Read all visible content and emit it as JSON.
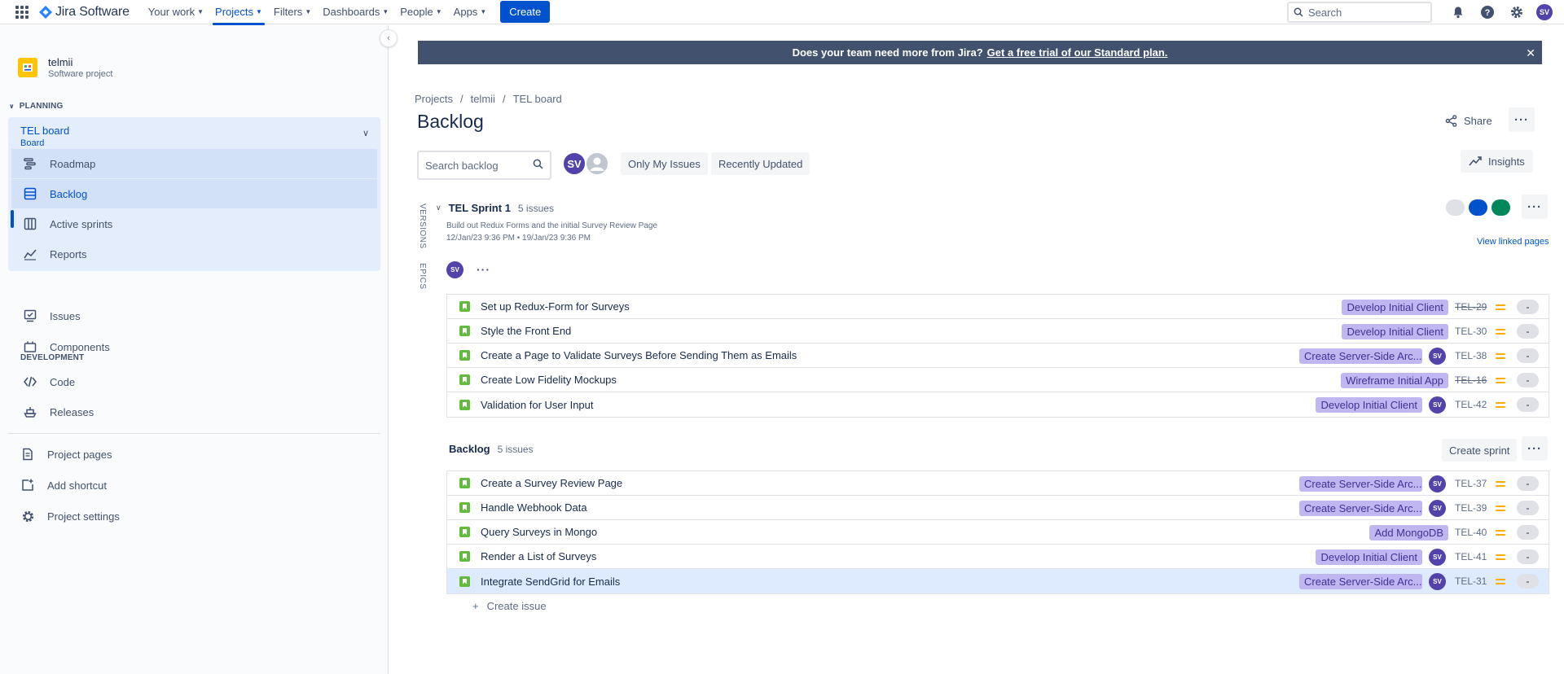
{
  "topnav": {
    "product": "Jira Software",
    "items": [
      "Your work",
      "Projects",
      "Filters",
      "Dashboards",
      "People",
      "Apps"
    ],
    "create_label": "Create",
    "search_placeholder": "Search",
    "user_initials": "SV"
  },
  "sidebar": {
    "project_name": "telmii",
    "project_type": "Software project",
    "planning_title": "PLANNING",
    "board_name": "TEL board",
    "board_type": "Board",
    "board_items": [
      "Roadmap",
      "Backlog",
      "Active sprints",
      "Reports"
    ],
    "items": [
      "Issues",
      "Components"
    ],
    "development_title": "DEVELOPMENT",
    "dev_items": [
      "Code",
      "Releases"
    ],
    "bottom_items": [
      "Project pages",
      "Add shortcut",
      "Project settings"
    ]
  },
  "banner": {
    "text": "Does your team need more from Jira?",
    "link": "Get a free trial of our Standard plan."
  },
  "breadcrumb": [
    "Projects",
    "telmii",
    "TEL board"
  ],
  "page_title": "Backlog",
  "share_label": "Share",
  "search_placeholder": "Search backlog",
  "filter_avatar": "SV",
  "filters": [
    "Only My Issues",
    "Recently Updated"
  ],
  "insights_label": "Insights",
  "side_tabs": [
    "VERSIONS",
    "EPICS"
  ],
  "sprint": {
    "name": "TEL Sprint 1",
    "count": "5 issues",
    "goal": "Build out Redux Forms and the initial Survey Review Page",
    "dates": "12/Jan/23 9:36 PM • 19/Jan/23 9:36 PM",
    "status_colors": [
      "#dfe1e6",
      "#0052cc",
      "#00875a"
    ],
    "view_linked": "View linked pages",
    "avatar": "SV",
    "issues": [
      {
        "summary": "Set up Redux-Form for Surveys",
        "epic": "Develop Initial Client",
        "avatar": "",
        "key": "TEL-29",
        "done": true,
        "estimate": "-"
      },
      {
        "summary": "Style the Front End",
        "epic": "Develop Initial Client",
        "avatar": "",
        "key": "TEL-30",
        "done": false,
        "estimate": "-"
      },
      {
        "summary": "Create a Page to Validate Surveys Before Sending Them as Emails",
        "epic": "Create Server-Side Arc...",
        "avatar": "SV",
        "key": "TEL-38",
        "done": false,
        "estimate": "-"
      },
      {
        "summary": "Create Low Fidelity Mockups",
        "epic": "Wireframe Initial App",
        "avatar": "",
        "key": "TEL-16",
        "done": true,
        "estimate": "-"
      },
      {
        "summary": "Validation for User Input",
        "epic": "Develop Initial Client",
        "avatar": "SV",
        "key": "TEL-42",
        "done": false,
        "estimate": "-"
      }
    ]
  },
  "backlog": {
    "name": "Backlog",
    "count": "5 issues",
    "create_sprint": "Create sprint",
    "create_issue": "Create issue",
    "issues": [
      {
        "summary": "Create a Survey Review Page",
        "epic": "Create Server-Side Arc...",
        "avatar": "SV",
        "key": "TEL-37",
        "done": false,
        "estimate": "-"
      },
      {
        "summary": "Handle Webhook Data",
        "epic": "Create Server-Side Arc...",
        "avatar": "SV",
        "key": "TEL-39",
        "done": false,
        "estimate": "-"
      },
      {
        "summary": "Query Surveys in Mongo",
        "epic": "Add MongoDB",
        "avatar": "",
        "key": "TEL-40",
        "done": false,
        "estimate": "-"
      },
      {
        "summary": "Render a List of Surveys",
        "epic": "Develop Initial Client",
        "avatar": "SV",
        "key": "TEL-41",
        "done": false,
        "estimate": "-"
      },
      {
        "summary": "Integrate SendGrid for Emails",
        "epic": "Create Server-Side Arc...",
        "avatar": "SV",
        "key": "TEL-31",
        "done": false,
        "estimate": "-"
      }
    ]
  }
}
